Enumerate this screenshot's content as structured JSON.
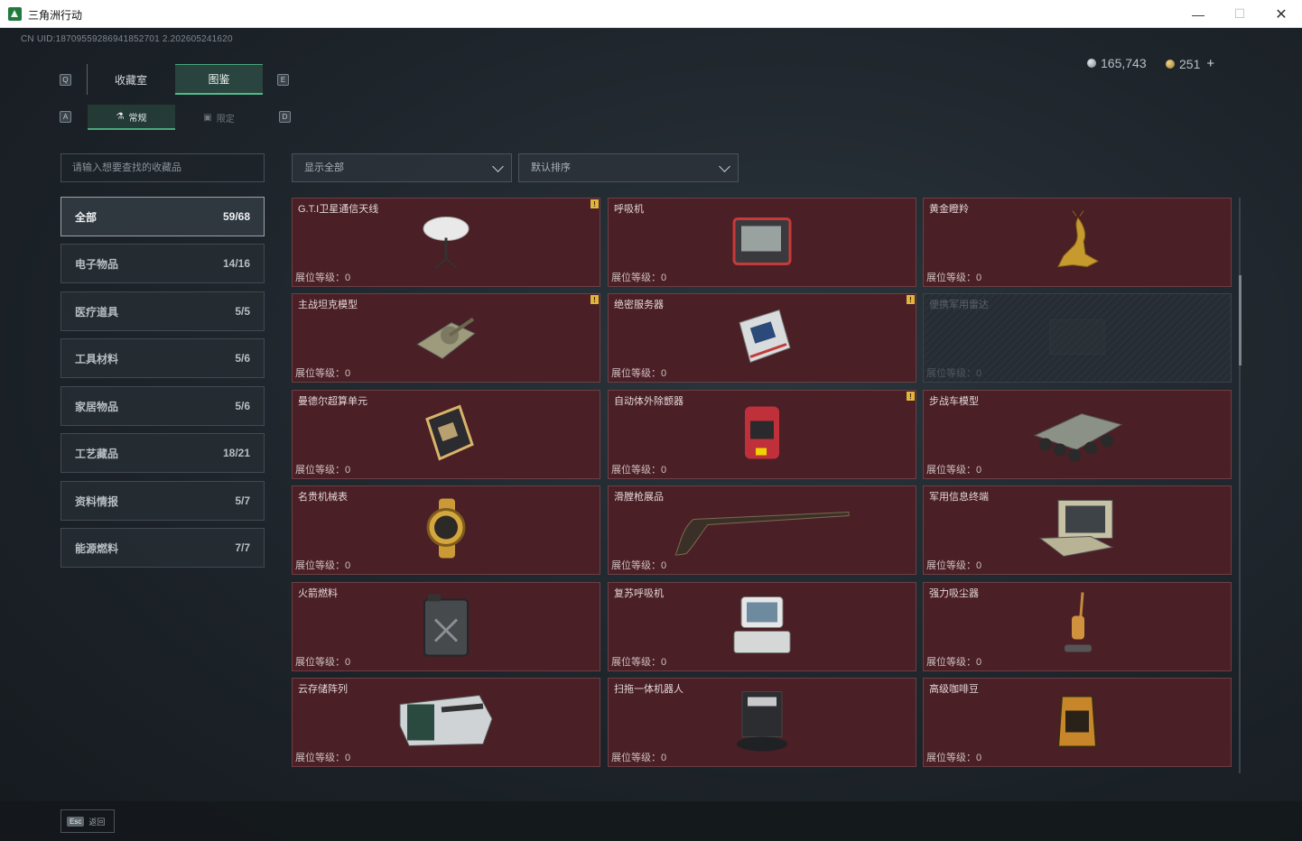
{
  "window": {
    "title": "三角洲行动",
    "minimize": "—",
    "maximize": "☐",
    "close": "✕"
  },
  "header": {
    "uid": "CN UID:18709559286941852701 2.202605241620",
    "currencies": [
      {
        "icon": "silver-coin-icon",
        "value": "165,743"
      },
      {
        "icon": "gold-coin-icon",
        "value": "251"
      }
    ],
    "plus": "+"
  },
  "key_hints": {
    "tab_left": "Q",
    "tab_right": "E",
    "sub_left": "A",
    "sub_right": "D"
  },
  "tabs": [
    {
      "label": "收藏室"
    },
    {
      "label": "图鉴"
    }
  ],
  "subtabs": [
    {
      "label": "常规",
      "icon": "flask-icon"
    },
    {
      "label": "限定",
      "icon": "image-icon"
    }
  ],
  "search": {
    "placeholder": "请输入想要查找的收藏品"
  },
  "filters": {
    "display": "显示全部",
    "sort": "默认排序"
  },
  "categories": [
    {
      "label": "全部",
      "count": "59/68"
    },
    {
      "label": "电子物品",
      "count": "14/16"
    },
    {
      "label": "医疗道具",
      "count": "5/5"
    },
    {
      "label": "工具材料",
      "count": "5/6"
    },
    {
      "label": "家居物品",
      "count": "5/6"
    },
    {
      "label": "工艺藏品",
      "count": "18/21"
    },
    {
      "label": "资料情报",
      "count": "5/7"
    },
    {
      "label": "能源燃料",
      "count": "7/7"
    }
  ],
  "level_label": "展位等级：0",
  "items": [
    {
      "name": "G.T.I卫星通信天线",
      "icon": "satellite-dish-icon",
      "new": true,
      "locked": false
    },
    {
      "name": "呼吸机",
      "icon": "ventilator-icon",
      "new": false,
      "locked": false
    },
    {
      "name": "黄金瞪羚",
      "icon": "gold-gazelle-icon",
      "new": false,
      "locked": false
    },
    {
      "name": "主战坦克模型",
      "icon": "tank-model-icon",
      "new": true,
      "locked": false
    },
    {
      "name": "绝密服务器",
      "icon": "server-icon",
      "new": true,
      "locked": false
    },
    {
      "name": "便携军用雷达",
      "icon": "radar-icon",
      "new": false,
      "locked": true
    },
    {
      "name": "曼德尔超算单元",
      "icon": "compute-unit-icon",
      "new": false,
      "locked": false
    },
    {
      "name": "自动体外除颤器",
      "icon": "defibrillator-icon",
      "new": true,
      "locked": false
    },
    {
      "name": "步战车模型",
      "icon": "ifv-model-icon",
      "new": false,
      "locked": false
    },
    {
      "name": "名贵机械表",
      "icon": "watch-icon",
      "new": false,
      "locked": false
    },
    {
      "name": "滑膛枪展品",
      "icon": "musket-icon",
      "new": false,
      "locked": false
    },
    {
      "name": "军用信息终端",
      "icon": "military-terminal-icon",
      "new": false,
      "locked": false
    },
    {
      "name": "火箭燃料",
      "icon": "fuel-can-icon",
      "new": false,
      "locked": false
    },
    {
      "name": "复苏呼吸机",
      "icon": "resuscitator-icon",
      "new": false,
      "locked": false
    },
    {
      "name": "强力吸尘器",
      "icon": "vacuum-icon",
      "new": false,
      "locked": false
    },
    {
      "name": "云存储阵列",
      "icon": "storage-array-icon",
      "new": false,
      "locked": false
    },
    {
      "name": "扫拖一体机器人",
      "icon": "robot-vacuum-icon",
      "new": false,
      "locked": false
    },
    {
      "name": "高级咖啡豆",
      "icon": "coffee-bag-icon",
      "new": false,
      "locked": false
    }
  ],
  "footer": {
    "esc_key": "Esc",
    "esc_label": "返回"
  }
}
